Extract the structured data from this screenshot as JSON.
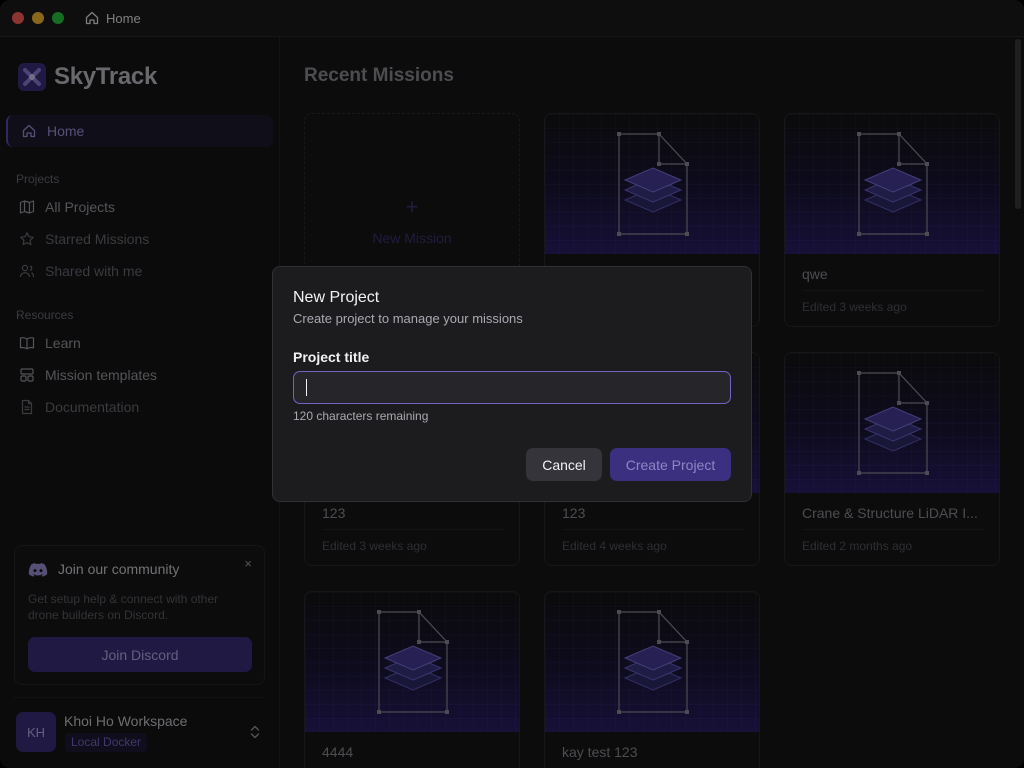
{
  "window": {
    "title": "Home"
  },
  "app": {
    "name": "SkyTrack"
  },
  "sidebar": {
    "home_label": "Home",
    "projects_section": "Projects",
    "projects_items": [
      {
        "label": "All Projects",
        "icon": "map-icon"
      },
      {
        "label": "Starred Missions",
        "icon": "star-icon"
      },
      {
        "label": "Shared with me",
        "icon": "users-icon"
      }
    ],
    "resources_section": "Resources",
    "resources_items": [
      {
        "label": "Learn",
        "icon": "book-icon"
      },
      {
        "label": "Mission templates",
        "icon": "template-icon"
      },
      {
        "label": "Documentation",
        "icon": "document-icon"
      }
    ],
    "community": {
      "title": "Join our community",
      "description": "Get setup help & connect with other drone builders on Discord.",
      "button": "Join Discord",
      "close": "×"
    },
    "workspace": {
      "initials": "KH",
      "name": "Khoi Ho Workspace",
      "badge": "Local Docker"
    }
  },
  "main": {
    "title": "Recent Missions",
    "new_mission": {
      "plus": "+",
      "label": "New Mission"
    },
    "missions": [
      {
        "name": "",
        "edited": ""
      },
      {
        "name": "qwe",
        "edited": "Edited 3 weeks ago"
      },
      {
        "name": "123",
        "edited": "Edited 3 weeks ago"
      },
      {
        "name": "123",
        "edited": "Edited 4 weeks ago"
      },
      {
        "name": "Crane & Structure LiDAR I...",
        "edited": "Edited 2 months ago"
      },
      {
        "name": "4444",
        "edited": ""
      },
      {
        "name": "kay test 123",
        "edited": ""
      }
    ]
  },
  "modal": {
    "title": "New Project",
    "subtitle": "Create project to manage your missions",
    "field_label": "Project title",
    "field_value": "",
    "hint": "120 characters remaining",
    "cancel": "Cancel",
    "create": "Create Project"
  },
  "colors": {
    "accent": "#6f63c4",
    "brand": "#3b2f80",
    "background": "#101012"
  }
}
